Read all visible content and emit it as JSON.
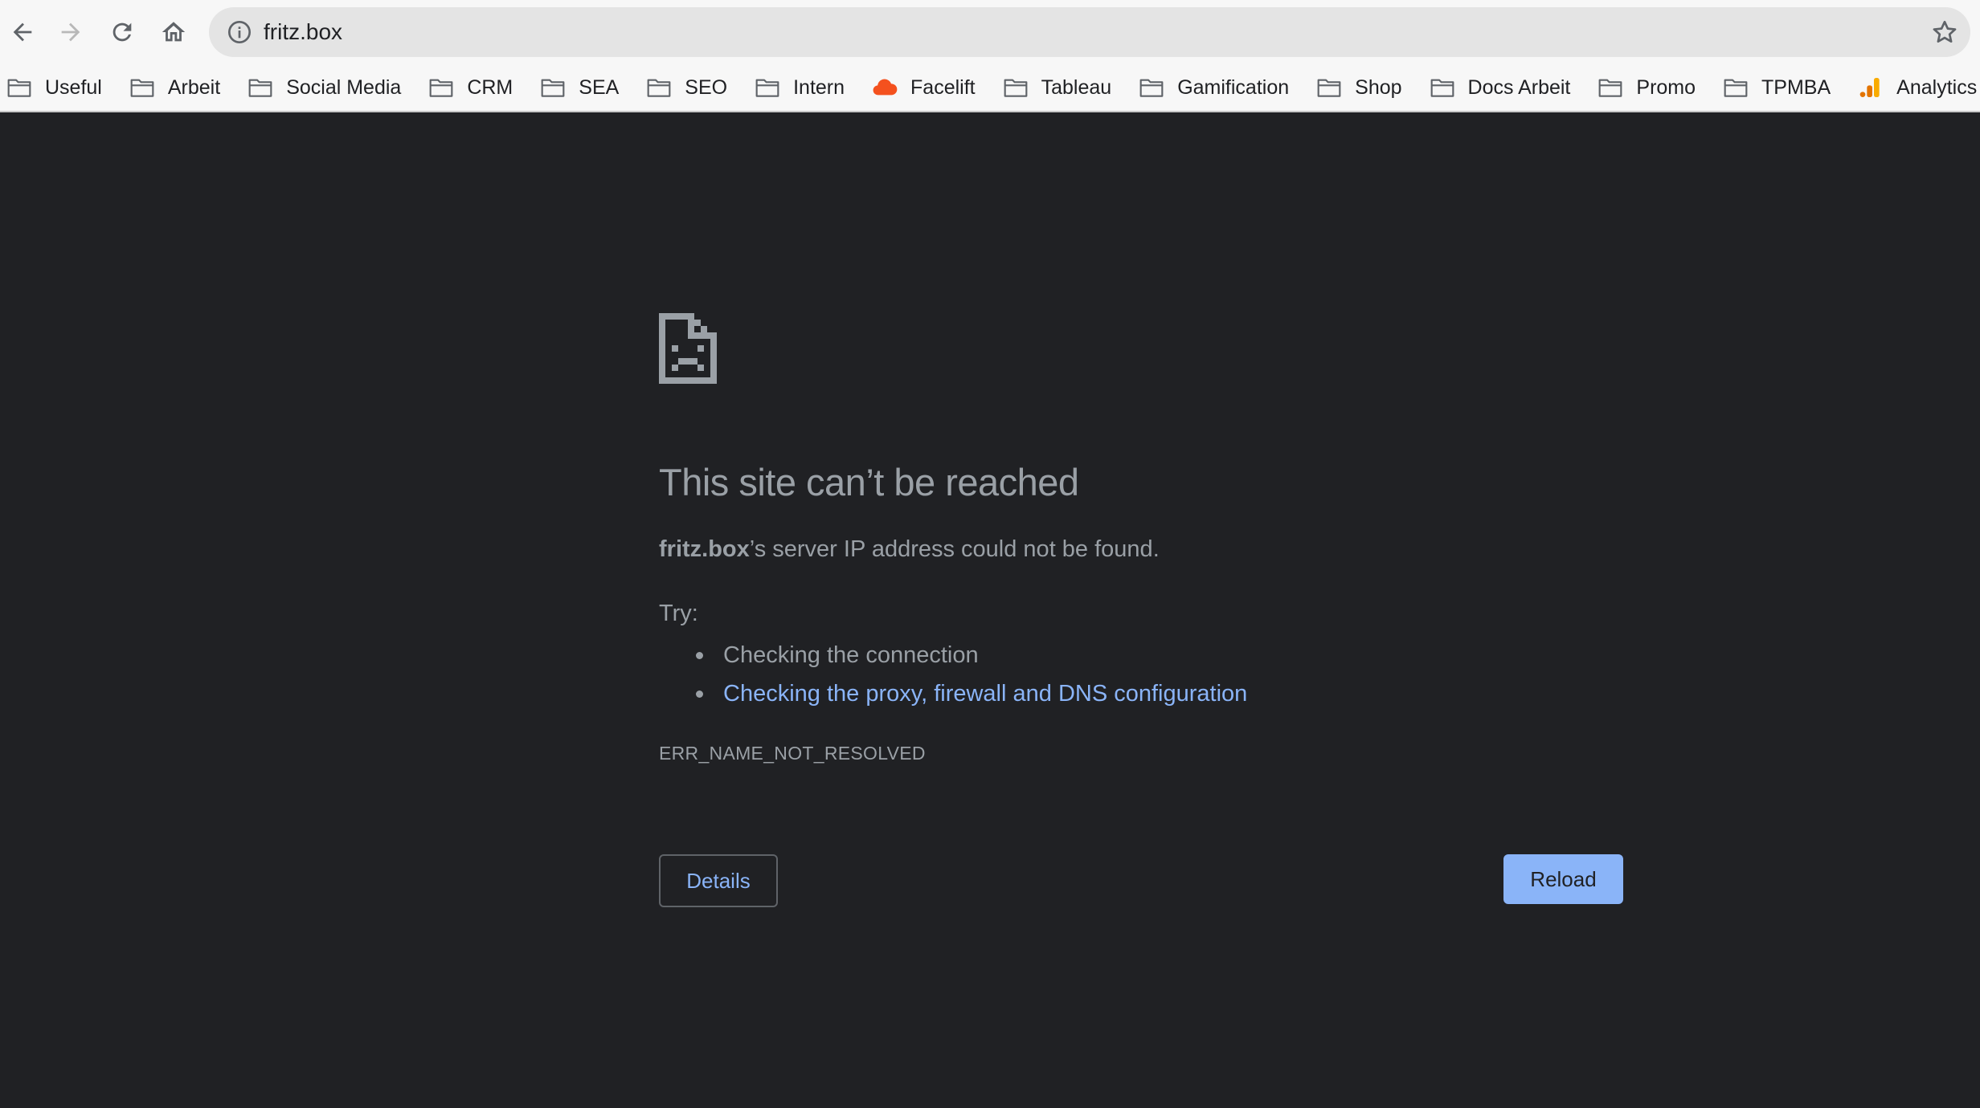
{
  "browser": {
    "url": "fritz.box",
    "nav": {
      "back": "back-arrow-icon",
      "forward": "forward-arrow-icon",
      "reload": "reload-icon",
      "home": "home-icon"
    }
  },
  "bookmarks": [
    {
      "label": "Useful",
      "icon": "folder-icon"
    },
    {
      "label": "Arbeit",
      "icon": "folder-icon"
    },
    {
      "label": "Social Media",
      "icon": "folder-icon"
    },
    {
      "label": "CRM",
      "icon": "folder-icon"
    },
    {
      "label": "SEA",
      "icon": "folder-icon"
    },
    {
      "label": "SEO",
      "icon": "folder-icon"
    },
    {
      "label": "Intern",
      "icon": "folder-icon"
    },
    {
      "label": "Facelift",
      "icon": "cloud-icon"
    },
    {
      "label": "Tableau",
      "icon": "folder-icon"
    },
    {
      "label": "Gamification",
      "icon": "folder-icon"
    },
    {
      "label": "Shop",
      "icon": "folder-icon"
    },
    {
      "label": "Docs Arbeit",
      "icon": "folder-icon"
    },
    {
      "label": "Promo",
      "icon": "folder-icon"
    },
    {
      "label": "TPMBA",
      "icon": "folder-icon"
    },
    {
      "label": "Analytics",
      "icon": "analytics-icon"
    }
  ],
  "error": {
    "heading": "This site can’t be reached",
    "host": "fritz.box",
    "message_suffix": "’s server IP address could not be found.",
    "try_label": "Try:",
    "suggestions": [
      "Checking the connection",
      "Checking the proxy, firewall and DNS configuration"
    ],
    "code": "ERR_NAME_NOT_RESOLVED",
    "details_label": "Details",
    "reload_label": "Reload"
  },
  "colors": {
    "page_bg": "#202124",
    "text": "#9aa0a6",
    "link": "#8ab4f8",
    "reload_bg": "#8ab4f8",
    "facelift_cloud": "#f4511e",
    "analytics": "#f9ab00"
  }
}
